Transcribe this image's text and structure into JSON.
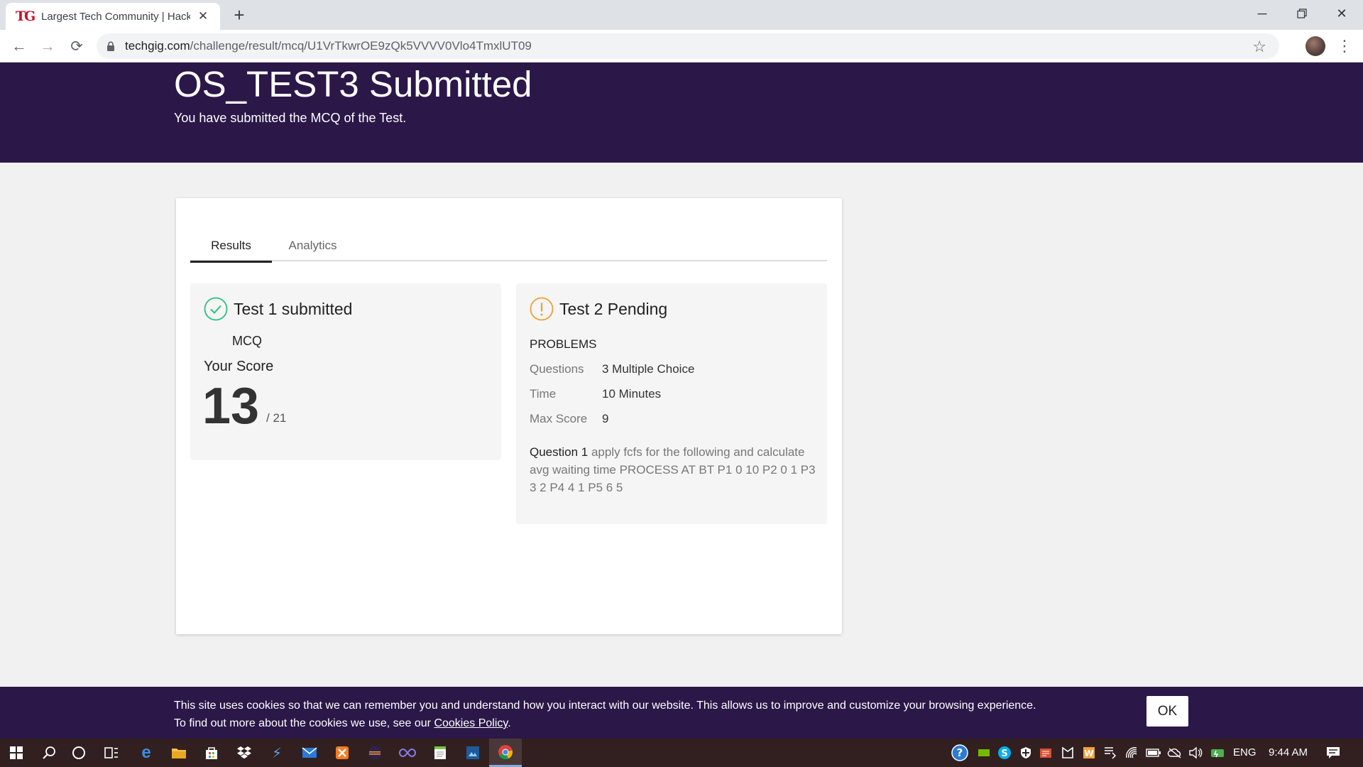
{
  "browser": {
    "tab_title": "Largest Tech Community | Hackathons",
    "tab_favicon_text": "TG",
    "url_domain": "techgig.com",
    "url_path": "/challenge/result/mcq/U1VrTkwrOE9zQk5VVVV0Vlo4TmxlUT09"
  },
  "hero": {
    "title": "OS_TEST3 Submitted",
    "subtitle": "You have submitted the MCQ of the Test."
  },
  "tabs": {
    "results": "Results",
    "analytics": "Analytics"
  },
  "test1": {
    "title": "Test 1 submitted",
    "type": "MCQ",
    "score_label": "Your Score",
    "score": "13",
    "total": "/ 21"
  },
  "test2": {
    "title": "Test 2 Pending",
    "problems_label": "PROBLEMS",
    "rows": [
      {
        "key": "Questions",
        "value": "3 Multiple Choice"
      },
      {
        "key": "Time",
        "value": "10 Minutes"
      },
      {
        "key": "Max Score",
        "value": "9"
      }
    ],
    "question_label": "Question 1",
    "question_text": "apply fcfs for the following and calculate avg waiting time PROCESS AT BT P1 0 10 P2 0 1 P3 3 2 P4 4 1 P5 6 5"
  },
  "cookie": {
    "line1": "This site uses cookies so that we can remember you and understand how you interact with our website. This allows us to improve and customize your browsing experience.",
    "line2_prefix": "To find out more about the cookies we use, see our ",
    "link": "Cookies Policy",
    "line2_suffix": ".",
    "ok": "OK"
  },
  "taskbar": {
    "language": "ENG",
    "time": "9:44 AM"
  },
  "colors": {
    "brand_purple": "#2b1748",
    "success_green": "#2ebd85",
    "pending_orange": "#f0a030"
  }
}
